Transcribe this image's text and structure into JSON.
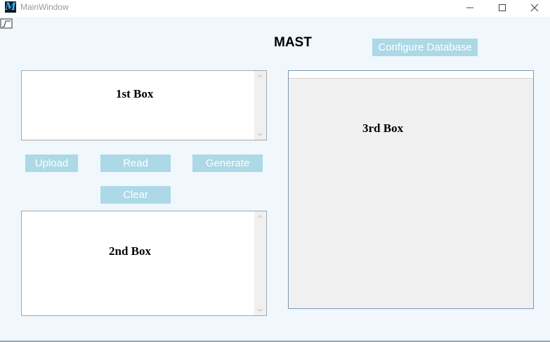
{
  "window": {
    "title": "MainWindow",
    "app_icon_glyph": "M",
    "controls": {
      "minimize": "minimize-icon",
      "maximize": "maximize-icon",
      "close": "close-icon"
    }
  },
  "header": {
    "title": "MAST"
  },
  "buttons": {
    "configure_database": "Configure Database",
    "upload": "Upload",
    "read": "Read",
    "generate": "Generate",
    "clear": "Clear"
  },
  "boxes": {
    "box1_label": "1st Box",
    "box2_label": "2nd Box",
    "box3_label": "3rd Box"
  },
  "colors": {
    "button_bg": "#add8e6",
    "button_text": "#ffffff",
    "client_bg": "#f0f7fd"
  }
}
